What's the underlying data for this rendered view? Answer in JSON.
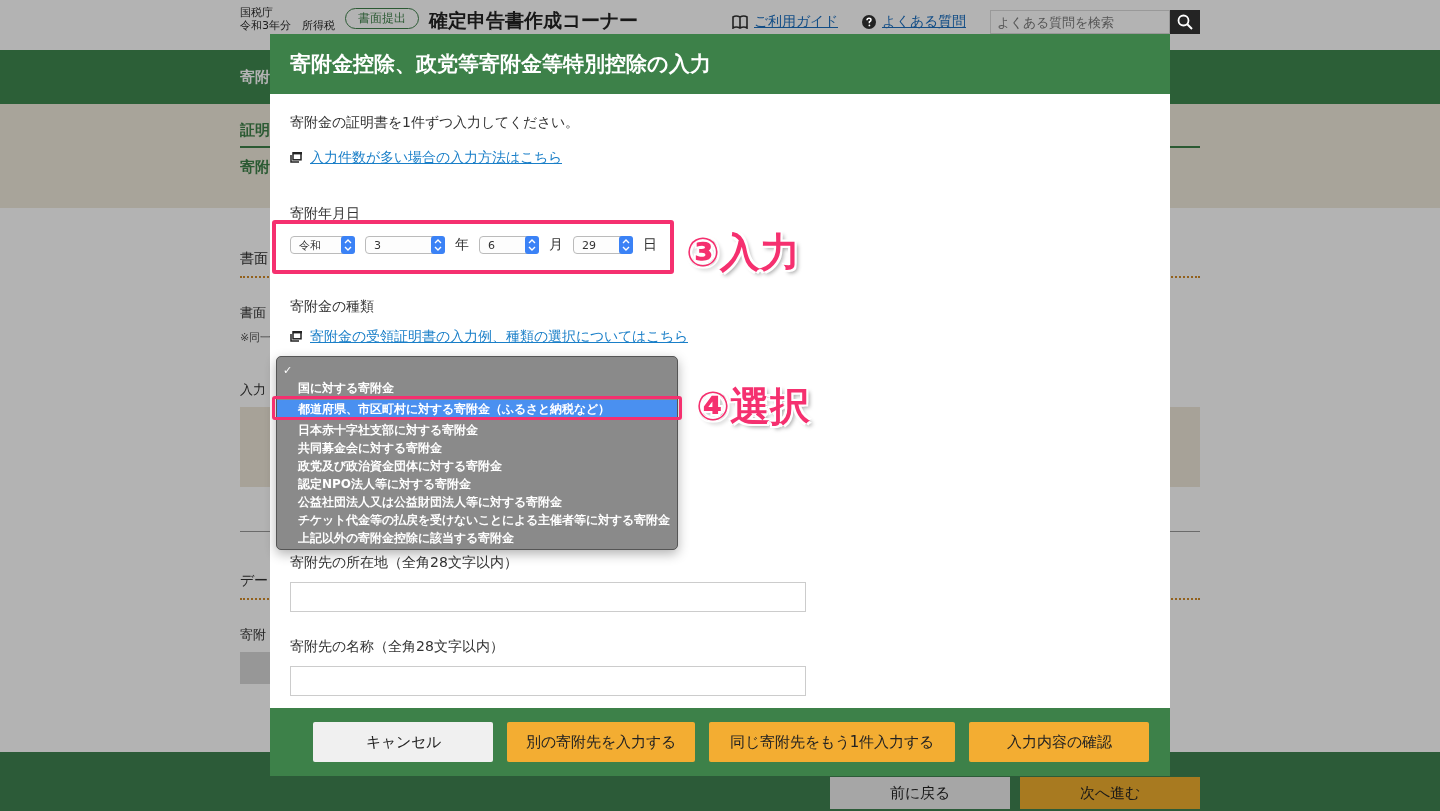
{
  "background_page": {
    "header": {
      "agency": "国税庁",
      "year": "令和3年分　所得税",
      "badge": "書面提出",
      "title": "確定申告書作成コーナー",
      "links": [
        {
          "label": "ご利用ガイド",
          "kind": "guide"
        },
        {
          "label": "よくある質問",
          "kind": "faq"
        }
      ],
      "search": {
        "placeholder": "よくある質問を検索"
      }
    },
    "step_bar": "寄附",
    "section_label": "証明",
    "page_title": "寄附",
    "body": [
      {
        "kind": "heading",
        "text": "書面"
      },
      {
        "kind": "text",
        "text": "書面"
      },
      {
        "kind": "note",
        "text": "※同一"
      },
      {
        "kind": "text",
        "text": "入力"
      },
      {
        "kind": "panel"
      },
      {
        "kind": "rule"
      },
      {
        "kind": "heading",
        "text": "デー"
      },
      {
        "kind": "text",
        "text": "寄附"
      },
      {
        "kind": "block"
      }
    ],
    "footer_buttons": [
      {
        "label": "前に戻る",
        "kind": "secondary"
      },
      {
        "label": "次へ進む",
        "kind": "primary"
      }
    ]
  },
  "dialog": {
    "title": "寄附金控除、政党等寄附金等特別控除の入力",
    "intro": "寄附金の証明書を1件ずつ入力してください。",
    "bulk_link": "入力件数が多い場合の入力方法はこちら",
    "date_label": "寄附年月日",
    "date_fields": [
      {
        "value": "令和"
      },
      {
        "value": "3",
        "unit": "年"
      },
      {
        "value": "6",
        "unit": "月"
      },
      {
        "value": "29",
        "unit": "日"
      }
    ],
    "type_label": "寄附金の種類",
    "type_link": "寄附金の受領証明書の入力例、種類の選択についてはこちら",
    "type_menu": {
      "check_mark": "✓",
      "options": [
        {
          "label": "国に対する寄附金",
          "highlighted": false
        },
        {
          "label": "都道府県、市区町村に対する寄附金（ふるさと納税など）",
          "highlighted": true
        },
        {
          "label": "日本赤十字社支部に対する寄附金",
          "highlighted": false
        },
        {
          "label": "共同募金会に対する寄附金",
          "highlighted": false
        },
        {
          "label": "政党及び政治資金団体に対する寄附金",
          "highlighted": false
        },
        {
          "label": "認定NPO法人等に対する寄附金",
          "highlighted": false
        },
        {
          "label": "公益社団法人又は公益財団法人等に対する寄附金",
          "highlighted": false
        },
        {
          "label": "チケット代金等の払戻を受けないことによる主催者等に対する寄附金",
          "highlighted": false
        },
        {
          "label": "上記以外の寄附金控除に該当する寄附金",
          "highlighted": false
        }
      ]
    },
    "fields": [
      {
        "label": "寄附先の所在地（全角28文字以内）"
      },
      {
        "label": "寄附先の名称（全角28文字以内）"
      }
    ],
    "buttons": [
      {
        "label": "キャンセル",
        "kind": "secondary"
      },
      {
        "label": "別の寄附先を入力する",
        "kind": "primary"
      },
      {
        "label": "同じ寄附先をもう1件入力する",
        "kind": "primary"
      },
      {
        "label": "入力内容の確認",
        "kind": "primary"
      }
    ]
  },
  "annotations": [
    {
      "text": "③入力"
    },
    {
      "text": "④選択"
    }
  ]
}
